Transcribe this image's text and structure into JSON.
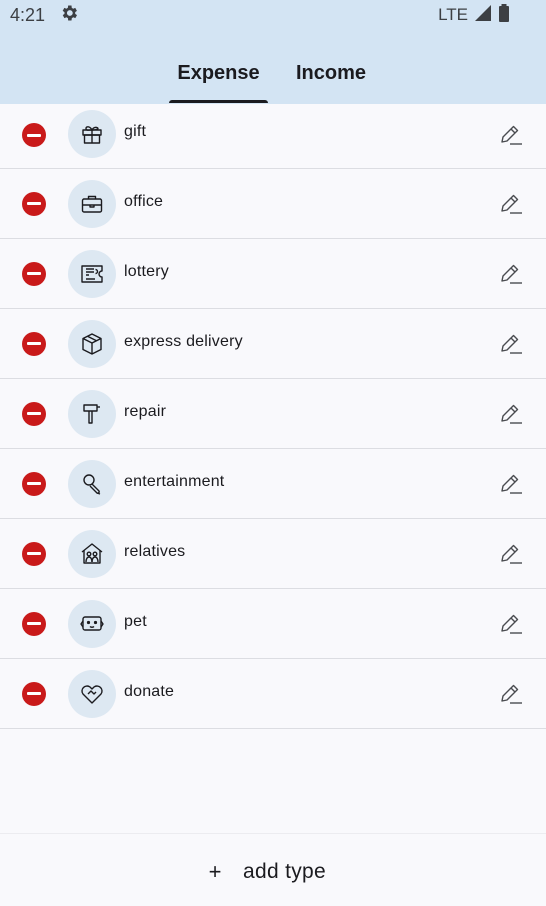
{
  "status_bar": {
    "time": "4:21",
    "network": "LTE"
  },
  "tabs": [
    {
      "label": "Expense",
      "selected": true
    },
    {
      "label": "Income",
      "selected": false
    }
  ],
  "categories": [
    {
      "label": "gift",
      "icon": "gift-icon"
    },
    {
      "label": "office",
      "icon": "briefcase-icon"
    },
    {
      "label": "lottery",
      "icon": "lottery-ticket-icon"
    },
    {
      "label": "express delivery",
      "icon": "package-icon"
    },
    {
      "label": "repair",
      "icon": "hammer-icon"
    },
    {
      "label": "entertainment",
      "icon": "microphone-icon"
    },
    {
      "label": "relatives",
      "icon": "family-house-icon"
    },
    {
      "label": "pet",
      "icon": "pet-face-icon"
    },
    {
      "label": "donate",
      "icon": "heart-hand-icon"
    }
  ],
  "add_button": {
    "icon": "+",
    "label": "add type"
  },
  "colors": {
    "header_bg": "#d3e4f3",
    "delete_red": "#c91a1a",
    "icon_circle_bg": "#dde8f2"
  }
}
